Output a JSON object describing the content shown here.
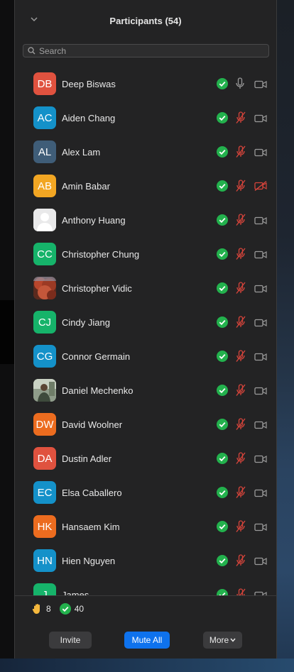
{
  "header": {
    "title": "Participants (54)"
  },
  "search": {
    "placeholder": "Search"
  },
  "participants": [
    {
      "initials": "DB",
      "name": "Deep Biswas",
      "color": "#e0523f",
      "mic": "on",
      "cam": "off"
    },
    {
      "initials": "AC",
      "name": "Aiden Chang",
      "color": "#1491c9",
      "mic": "muted",
      "cam": "off"
    },
    {
      "initials": "AL",
      "name": "Alex Lam",
      "color": "#3f5d78",
      "mic": "muted",
      "cam": "off"
    },
    {
      "initials": "AB",
      "name": "Amin Babar",
      "color": "#f2a623",
      "mic": "muted",
      "cam": "disabled"
    },
    {
      "initials": "",
      "name": "Anthony Huang",
      "color": "#e9e9ea",
      "avatar": "silhouette",
      "mic": "muted",
      "cam": "off"
    },
    {
      "initials": "CC",
      "name": "Christopher Chung",
      "color": "#16b36a",
      "mic": "muted",
      "cam": "off"
    },
    {
      "initials": "",
      "name": "Christopher Vidic",
      "color": "#8a3a2a",
      "avatar": "photo-autumn",
      "mic": "muted",
      "cam": "off"
    },
    {
      "initials": "CJ",
      "name": "Cindy Jiang",
      "color": "#16b36a",
      "mic": "muted",
      "cam": "off"
    },
    {
      "initials": "CG",
      "name": "Connor Germain",
      "color": "#1491c9",
      "mic": "muted",
      "cam": "off"
    },
    {
      "initials": "",
      "name": "Daniel Mechenko",
      "color": "#7a8a7a",
      "avatar": "photo-person",
      "mic": "muted",
      "cam": "off"
    },
    {
      "initials": "DW",
      "name": "David Woolner",
      "color": "#ec6c1f",
      "mic": "muted",
      "cam": "off"
    },
    {
      "initials": "DA",
      "name": "Dustin Adler",
      "color": "#e0523f",
      "mic": "muted",
      "cam": "off"
    },
    {
      "initials": "EC",
      "name": "Elsa Caballero",
      "color": "#1491c9",
      "mic": "muted",
      "cam": "off"
    },
    {
      "initials": "HK",
      "name": "Hansaem Kim",
      "color": "#ec6c1f",
      "mic": "muted",
      "cam": "off"
    },
    {
      "initials": "HN",
      "name": "Hien Nguyen",
      "color": "#1491c9",
      "mic": "muted",
      "cam": "off"
    },
    {
      "initials": "J",
      "name": "James",
      "color": "#16b36a",
      "mic": "muted",
      "cam": "off"
    }
  ],
  "footer": {
    "raised_hands": "8",
    "yes_count": "40",
    "invite_label": "Invite",
    "mute_all_label": "Mute All",
    "more_label": "More"
  },
  "colors": {
    "accent": "#0e72ed",
    "check": "#23b14d",
    "muted": "#d5443b",
    "icon_gray": "#9a9a9a"
  }
}
